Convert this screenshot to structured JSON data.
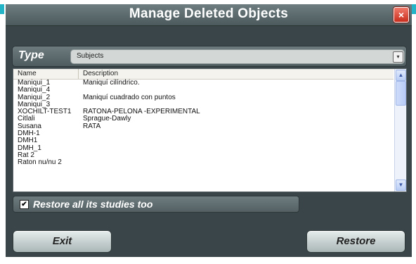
{
  "window": {
    "title": "Manage Deleted Objects",
    "close_icon": "×"
  },
  "type_selector": {
    "label": "Type",
    "value": "Subjects",
    "dropdown_icon": "▾"
  },
  "list": {
    "columns": [
      "Name",
      "Description"
    ],
    "rows": [
      {
        "name": "Maniqui_1",
        "description": "Maniquí cilíndrico."
      },
      {
        "name": "Maniqui_4",
        "description": ""
      },
      {
        "name": "Maniqui_2",
        "description": "Maniquí cuadrado con puntos"
      },
      {
        "name": "Maniqui_3",
        "description": ""
      },
      {
        "name": "XOCHILT-TEST1",
        "description": "RATONA-PELONA -EXPERIMENTAL"
      },
      {
        "name": "Citlali",
        "description": "Sprague-Dawly"
      },
      {
        "name": "Susana",
        "description": "RATA"
      },
      {
        "name": "DMH-1",
        "description": ""
      },
      {
        "name": "DMH1",
        "description": ""
      },
      {
        "name": "DMH_1",
        "description": ""
      },
      {
        "name": "Rat 2",
        "description": ""
      },
      {
        "name": "Raton nu/nu 2",
        "description": ""
      }
    ],
    "scroll_up_icon": "▲",
    "scroll_down_icon": "▼"
  },
  "restore_studies": {
    "checked": true,
    "check_mark": "✔",
    "label": "Restore all its studies too"
  },
  "buttons": {
    "exit": "Exit",
    "restore": "Restore"
  },
  "colors": {
    "dialog_bg": "#3a454a",
    "accent": "#24b4c8",
    "close_red": "#d9412f"
  }
}
